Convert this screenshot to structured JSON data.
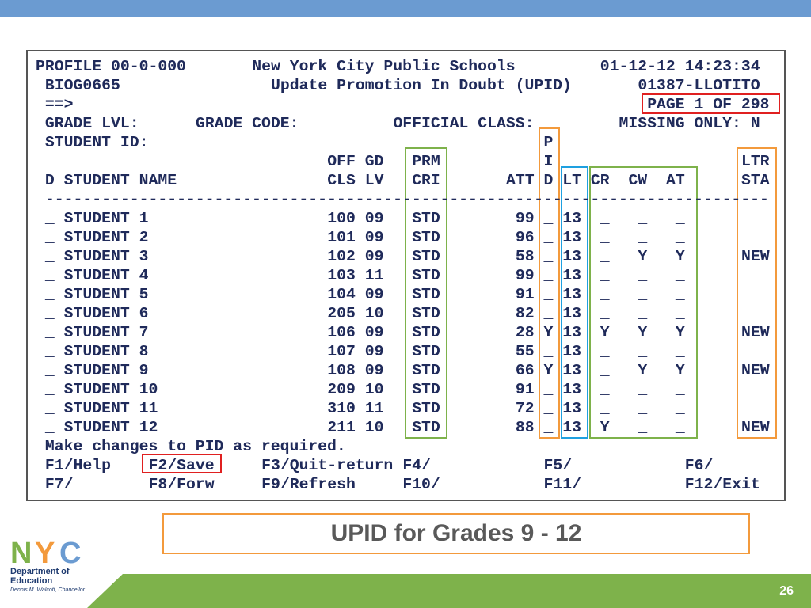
{
  "screen": {
    "header": [
      {
        "col": 0,
        "row": 0,
        "text": "PROFILE 00-0-000",
        "name": "profile-id"
      },
      {
        "col": 23,
        "row": 0,
        "text": "New York City Public Schools",
        "name": "system-title"
      },
      {
        "col": 60,
        "row": 0,
        "text": "01-12-12 14:23:34",
        "name": "timestamp"
      },
      {
        "col": 1,
        "row": 1,
        "text": "BIOG0665",
        "name": "screen-code"
      },
      {
        "col": 25,
        "row": 1,
        "text": "Update Promotion In Doubt (UPID)",
        "name": "screen-title"
      },
      {
        "col": 64,
        "row": 1,
        "text": "01387-LLOTITO",
        "name": "user-id"
      },
      {
        "col": 1,
        "row": 2,
        "text": "==>",
        "name": "command-prompt"
      },
      {
        "col": 65,
        "row": 2,
        "text": "PAGE 1 OF 298",
        "name": "page-indicator"
      },
      {
        "col": 1,
        "row": 3,
        "text": "GRADE LVL:",
        "name": "grade-lvl-label"
      },
      {
        "col": 17,
        "row": 3,
        "text": "GRADE CODE:",
        "name": "grade-code-label"
      },
      {
        "col": 38,
        "row": 3,
        "text": "OFFICIAL CLASS:",
        "name": "official-class-label"
      },
      {
        "col": 62,
        "row": 3,
        "text": "MISSING ONLY: N",
        "name": "missing-only-field"
      },
      {
        "col": 1,
        "row": 4,
        "text": "STUDENT ID:",
        "name": "student-id-label"
      },
      {
        "col": 54,
        "row": 4,
        "text": "P",
        "name": "col-header"
      },
      {
        "col": 31,
        "row": 5,
        "text": "OFF GD",
        "name": "col-header"
      },
      {
        "col": 40,
        "row": 5,
        "text": "PRM",
        "name": "col-header"
      },
      {
        "col": 54,
        "row": 5,
        "text": "I",
        "name": "col-header"
      },
      {
        "col": 75,
        "row": 5,
        "text": "LTR",
        "name": "col-header"
      },
      {
        "col": 1,
        "row": 6,
        "text": "D STUDENT NAME",
        "name": "col-header"
      },
      {
        "col": 31,
        "row": 6,
        "text": "CLS LV",
        "name": "col-header"
      },
      {
        "col": 40,
        "row": 6,
        "text": "CRI",
        "name": "col-header"
      },
      {
        "col": 50,
        "row": 6,
        "text": "ATT",
        "name": "col-header"
      },
      {
        "col": 54,
        "row": 6,
        "text": "D",
        "name": "col-header"
      },
      {
        "col": 56,
        "row": 6,
        "text": "LT",
        "name": "col-header"
      },
      {
        "col": 59,
        "row": 6,
        "text": "CR",
        "name": "col-header"
      },
      {
        "col": 63,
        "row": 6,
        "text": "CW",
        "name": "col-header"
      },
      {
        "col": 67,
        "row": 6,
        "text": "AT",
        "name": "col-header"
      },
      {
        "col": 75,
        "row": 6,
        "text": "STA",
        "name": "col-header"
      },
      {
        "col": 1,
        "row": 7,
        "text": "-----------------------------------------------------------------------------",
        "name": "separator"
      }
    ],
    "rows": [
      {
        "d": "_",
        "name": "STUDENT 1",
        "cls": "100",
        "lv": "09",
        "cri": "STD",
        "att": "99",
        "pid": "_",
        "lt": "13",
        "cr": "_",
        "cw": "_",
        "at": "_",
        "sta": ""
      },
      {
        "d": "_",
        "name": "STUDENT 2",
        "cls": "101",
        "lv": "09",
        "cri": "STD",
        "att": "96",
        "pid": "_",
        "lt": "13",
        "cr": "_",
        "cw": "_",
        "at": "_",
        "sta": ""
      },
      {
        "d": "_",
        "name": "STUDENT 3",
        "cls": "102",
        "lv": "09",
        "cri": "STD",
        "att": "58",
        "pid": "_",
        "lt": "13",
        "cr": "_",
        "cw": "Y",
        "at": "Y",
        "sta": "NEW"
      },
      {
        "d": "_",
        "name": "STUDENT 4",
        "cls": "103",
        "lv": "11",
        "cri": "STD",
        "att": "99",
        "pid": "_",
        "lt": "13",
        "cr": "_",
        "cw": "_",
        "at": "_",
        "sta": ""
      },
      {
        "d": "_",
        "name": "STUDENT 5",
        "cls": "104",
        "lv": "09",
        "cri": "STD",
        "att": "91",
        "pid": "_",
        "lt": "13",
        "cr": "_",
        "cw": "_",
        "at": "_",
        "sta": ""
      },
      {
        "d": "_",
        "name": "STUDENT 6",
        "cls": "205",
        "lv": "10",
        "cri": "STD",
        "att": "82",
        "pid": "_",
        "lt": "13",
        "cr": "_",
        "cw": "_",
        "at": "_",
        "sta": ""
      },
      {
        "d": "_",
        "name": "STUDENT 7",
        "cls": "106",
        "lv": "09",
        "cri": "STD",
        "att": "28",
        "pid": "Y",
        "lt": "13",
        "cr": "Y",
        "cw": "Y",
        "at": "Y",
        "sta": "NEW"
      },
      {
        "d": "_",
        "name": "STUDENT 8",
        "cls": "107",
        "lv": "09",
        "cri": "STD",
        "att": "55",
        "pid": "_",
        "lt": "13",
        "cr": "_",
        "cw": "_",
        "at": "_",
        "sta": ""
      },
      {
        "d": "_",
        "name": "STUDENT 9",
        "cls": "108",
        "lv": "09",
        "cri": "STD",
        "att": "66",
        "pid": "Y",
        "lt": "13",
        "cr": "_",
        "cw": "Y",
        "at": "Y",
        "sta": "NEW"
      },
      {
        "d": "_",
        "name": "STUDENT 10",
        "cls": "209",
        "lv": "10",
        "cri": "STD",
        "att": "91",
        "pid": "_",
        "lt": "13",
        "cr": "_",
        "cw": "_",
        "at": "_",
        "sta": ""
      },
      {
        "d": "_",
        "name": "STUDENT 11",
        "cls": "310",
        "lv": "11",
        "cri": "STD",
        "att": "72",
        "pid": "_",
        "lt": "13",
        "cr": "_",
        "cw": "_",
        "at": "_",
        "sta": ""
      },
      {
        "d": "_",
        "name": "STUDENT 12",
        "cls": "211",
        "lv": "10",
        "cri": "STD",
        "att": "88",
        "pid": "_",
        "lt": "13",
        "cr": "Y",
        "cw": "_",
        "at": "_",
        "sta": "NEW"
      }
    ],
    "message": "Make changes to PID as required.",
    "fkeys": [
      {
        "col": 1,
        "row": 21,
        "text": "F1/Help"
      },
      {
        "col": 12,
        "row": 21,
        "text": "F2/Save"
      },
      {
        "col": 24,
        "row": 21,
        "text": "F3/Quit-return"
      },
      {
        "col": 39,
        "row": 21,
        "text": "F4/"
      },
      {
        "col": 54,
        "row": 21,
        "text": "F5/"
      },
      {
        "col": 69,
        "row": 21,
        "text": "F6/"
      },
      {
        "col": 1,
        "row": 22,
        "text": "F7/"
      },
      {
        "col": 12,
        "row": 22,
        "text": "F8/Forw"
      },
      {
        "col": 24,
        "row": 22,
        "text": "F9/Refresh"
      },
      {
        "col": 39,
        "row": 22,
        "text": "F10/"
      },
      {
        "col": 54,
        "row": 22,
        "text": "F11/"
      },
      {
        "col": 69,
        "row": 22,
        "text": "F12/Exit"
      }
    ]
  },
  "slide": {
    "caption": "UPID for Grades 9 - 12",
    "page_number": "26",
    "logo_text": "NYC",
    "department": "Department of Education",
    "chancellor": "Dennis M. Walcott, Chancellor"
  },
  "colors": {
    "text": "#1f2a5a",
    "green": "#7eb24b",
    "orange": "#f39a3c",
    "blue": "#1ea0e0",
    "red": "#e02020",
    "topbar": "#6b9bd1"
  }
}
